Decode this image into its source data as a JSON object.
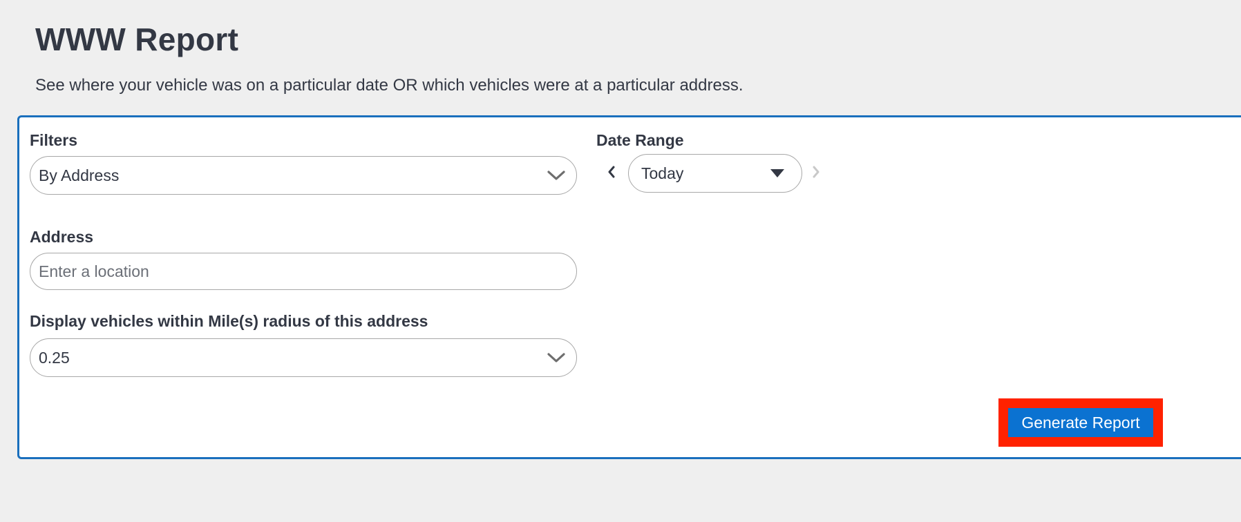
{
  "header": {
    "title": "WWW Report",
    "subtitle": "See where your vehicle was on a particular date OR which vehicles were at a particular address."
  },
  "filters": {
    "label": "Filters",
    "selected": "By Address"
  },
  "date_range": {
    "label": "Date Range",
    "selected": "Today"
  },
  "address": {
    "label": "Address",
    "placeholder": "Enter a location",
    "value": ""
  },
  "radius": {
    "label": "Display vehicles within Mile(s) radius of this address",
    "selected": "0.25"
  },
  "actions": {
    "generate_label": "Generate Report"
  },
  "colors": {
    "accent": "#0b72d1",
    "card_border": "#1a6fbd",
    "highlight": "#ff2200",
    "background": "#efefef"
  },
  "icons": {
    "filters_dropdown": "chevron-down-icon",
    "radius_dropdown": "chevron-down-icon",
    "date_dropdown": "caret-down-icon",
    "date_prev": "chevron-left-icon",
    "date_next": "chevron-right-icon"
  }
}
